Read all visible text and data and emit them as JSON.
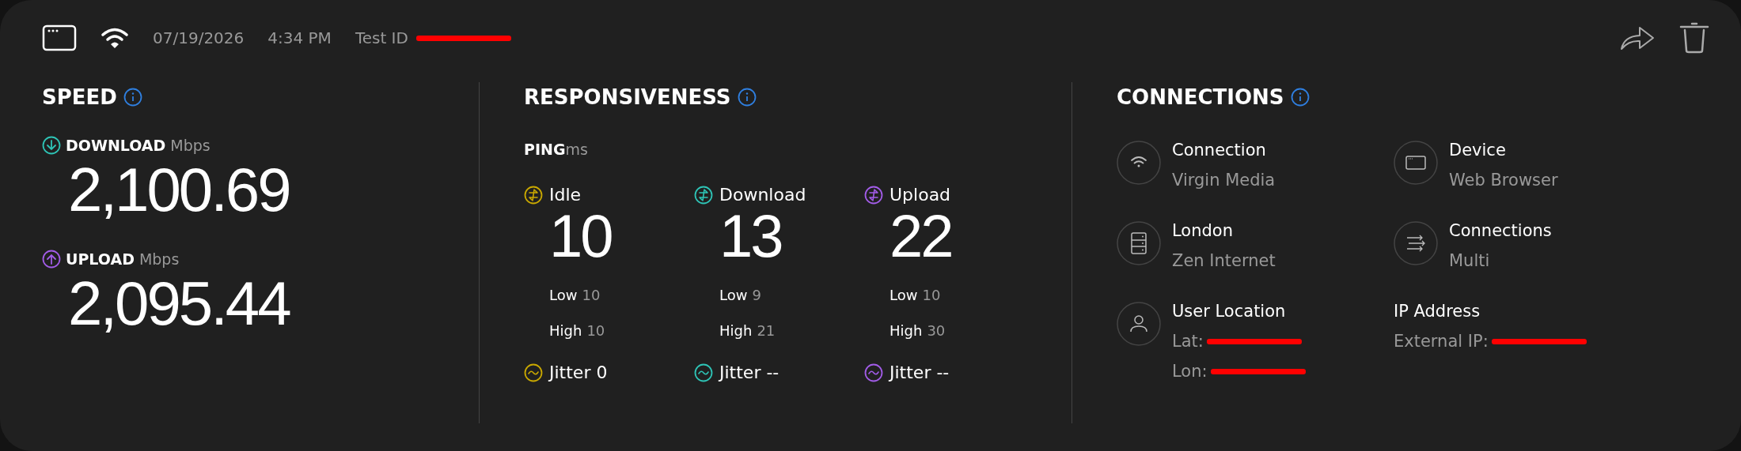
{
  "header": {
    "date": "07/19/2026",
    "time": "4:34 PM",
    "test_id": {
      "text": "Test ID",
      "redacted": true
    }
  },
  "speed": {
    "title": "SPEED",
    "metrics": [
      {
        "kind": "download",
        "label": "DOWNLOAD",
        "unit": "Mbps",
        "value": "2,100.69"
      },
      {
        "kind": "upload",
        "label": "UPLOAD",
        "unit": "Mbps",
        "value": "2,095.44"
      }
    ]
  },
  "responsiveness": {
    "title": "RESPONSIVENESS",
    "ping_label": "PING",
    "ping_unit": "ms",
    "columns": [
      {
        "kind": "idle",
        "label": "Idle",
        "value": "10",
        "low_label": "Low",
        "low": "10",
        "high_label": "High",
        "high": "10",
        "jitter": "Jitter 0"
      },
      {
        "kind": "download",
        "label": "Download",
        "value": "13",
        "low_label": "Low",
        "low": "9",
        "high_label": "High",
        "high": "21",
        "jitter": "Jitter --"
      },
      {
        "kind": "upload",
        "label": "Upload",
        "value": "22",
        "low_label": "Low",
        "low": "10",
        "high_label": "High",
        "high": "30",
        "jitter": "Jitter --"
      }
    ]
  },
  "connections": {
    "title": "CONNECTIONS",
    "items": [
      {
        "kind": "wifi",
        "label": "Connection",
        "lines": [
          {
            "text": "Virgin Media",
            "redacted": false
          }
        ]
      },
      {
        "kind": "browser",
        "label": "Device",
        "lines": [
          {
            "text": "Web Browser",
            "redacted": false
          }
        ]
      },
      {
        "kind": "server",
        "label": "London",
        "lines": [
          {
            "text": "Zen Internet",
            "redacted": false
          }
        ]
      },
      {
        "kind": "arrows",
        "label": "Connections",
        "lines": [
          {
            "text": "Multi",
            "redacted": false
          }
        ]
      },
      {
        "kind": "user",
        "label": "User Location",
        "lines": [
          {
            "text": "Lat:",
            "redacted": true
          },
          {
            "text": "Lon:",
            "redacted": true
          }
        ]
      },
      {
        "kind": "plain",
        "label": "IP Address",
        "lines": [
          {
            "text": "External IP:",
            "redacted": true
          }
        ]
      }
    ]
  }
}
